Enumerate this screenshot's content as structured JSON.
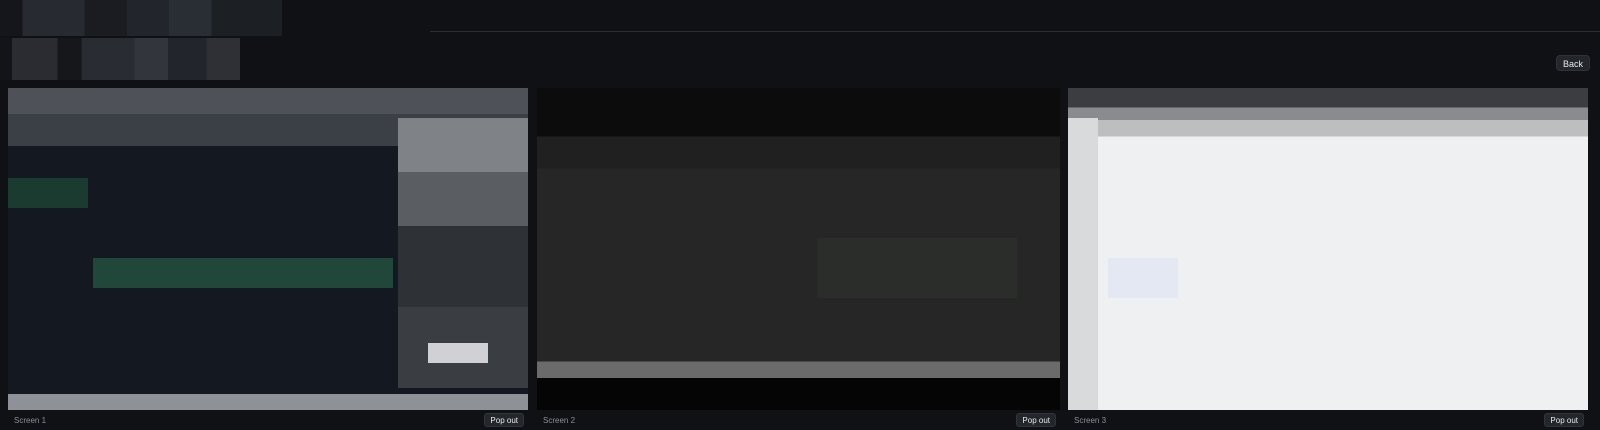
{
  "toolbar": {
    "back_label": "Back"
  },
  "screens": [
    {
      "label": "Screen 1",
      "popout_label": "Pop out"
    },
    {
      "label": "Screen 2",
      "popout_label": "Pop out"
    },
    {
      "label": "Screen 3",
      "popout_label": "Pop out"
    }
  ]
}
